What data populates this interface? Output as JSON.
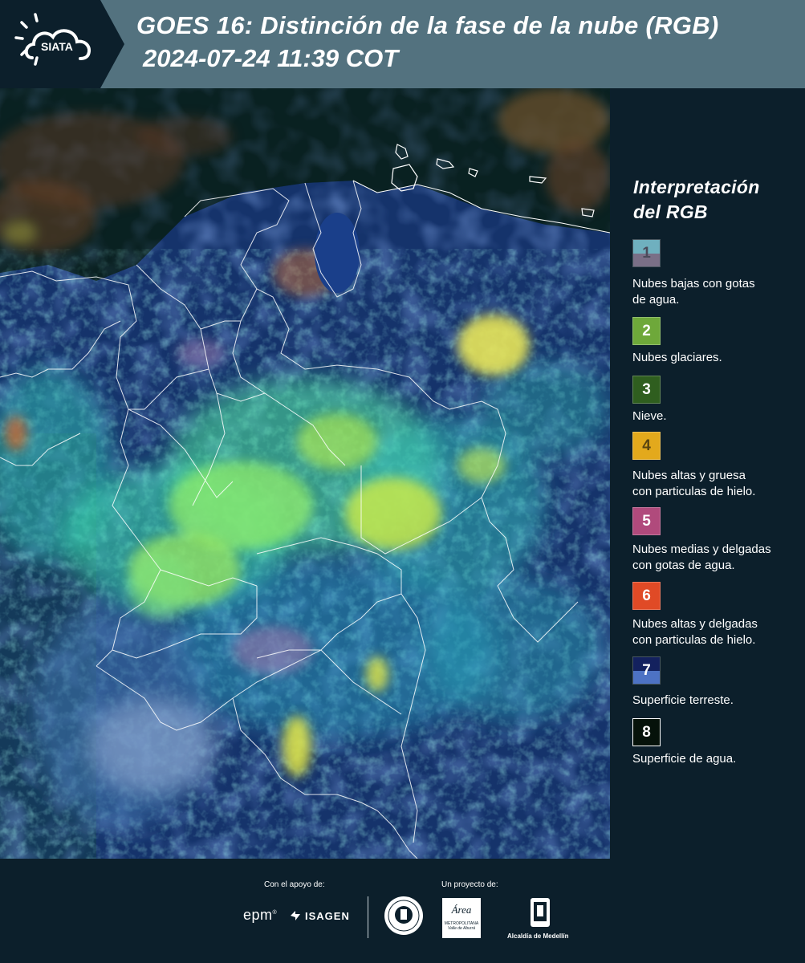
{
  "header": {
    "logo_text": "SIATA",
    "title_line1": "GOES 16: Distinción de la fase de la nube (RGB)",
    "title_line2": "2024-07-24 11:39 COT"
  },
  "legend": {
    "title_line1": "Interpretación",
    "title_line2": "del RGB",
    "items": [
      {
        "number": "1",
        "label_line1": "Nubes bajas con gotas",
        "label_line2": "de agua.",
        "color_top": "#6fb0bf",
        "color_bottom": "#7a6f87",
        "num_color": "#4a4a5a"
      },
      {
        "number": "2",
        "label_line1": "Nubes glaciares.",
        "label_line2": "",
        "color_top": "#6ea83a",
        "color_bottom": "#6ea83a",
        "num_color": "#ffffff"
      },
      {
        "number": "3",
        "label_line1": "Nieve.",
        "label_line2": "",
        "color_top": "#2f5e1f",
        "color_bottom": "#2f5e1f",
        "num_color": "#ffffff"
      },
      {
        "number": "4",
        "label_line1": "Nubes altas y gruesa",
        "label_line2": "con particulas de hielo.",
        "color_top": "#e3a91c",
        "color_bottom": "#e3a91c",
        "num_color": "#5a4510"
      },
      {
        "number": "5",
        "label_line1": "Nubes medias y delgadas",
        "label_line2": "con gotas de agua.",
        "color_top": "#b04a7c",
        "color_bottom": "#b04a7c",
        "num_color": "#ffffff"
      },
      {
        "number": "6",
        "label_line1": "Nubes altas y delgadas",
        "label_line2": "con particulas de hielo.",
        "color_top": "#e04a26",
        "color_bottom": "#e04a26",
        "num_color": "#ffffff"
      },
      {
        "number": "7",
        "label_line1": "Superficie terreste.",
        "label_line2": "",
        "color_top": "#13215e",
        "color_bottom": "#4d72c4",
        "num_color": "#ffffff"
      },
      {
        "number": "8",
        "label_line1": "Superficie de agua.",
        "label_line2": "",
        "color_top": "#06120a",
        "color_bottom": "#06120a",
        "num_color": "#ffffff"
      }
    ]
  },
  "footer": {
    "support_label": "Con el apoyo de:",
    "project_label": "Un proyecto de:",
    "epm_text": "epm",
    "isagen_text": "ISAGEN",
    "area_text": "Área",
    "area_sub1": "METROPOLITANA",
    "area_sub2": "Valle de Aburrá",
    "alcaldia_text": "Alcaldía de Medellín"
  }
}
